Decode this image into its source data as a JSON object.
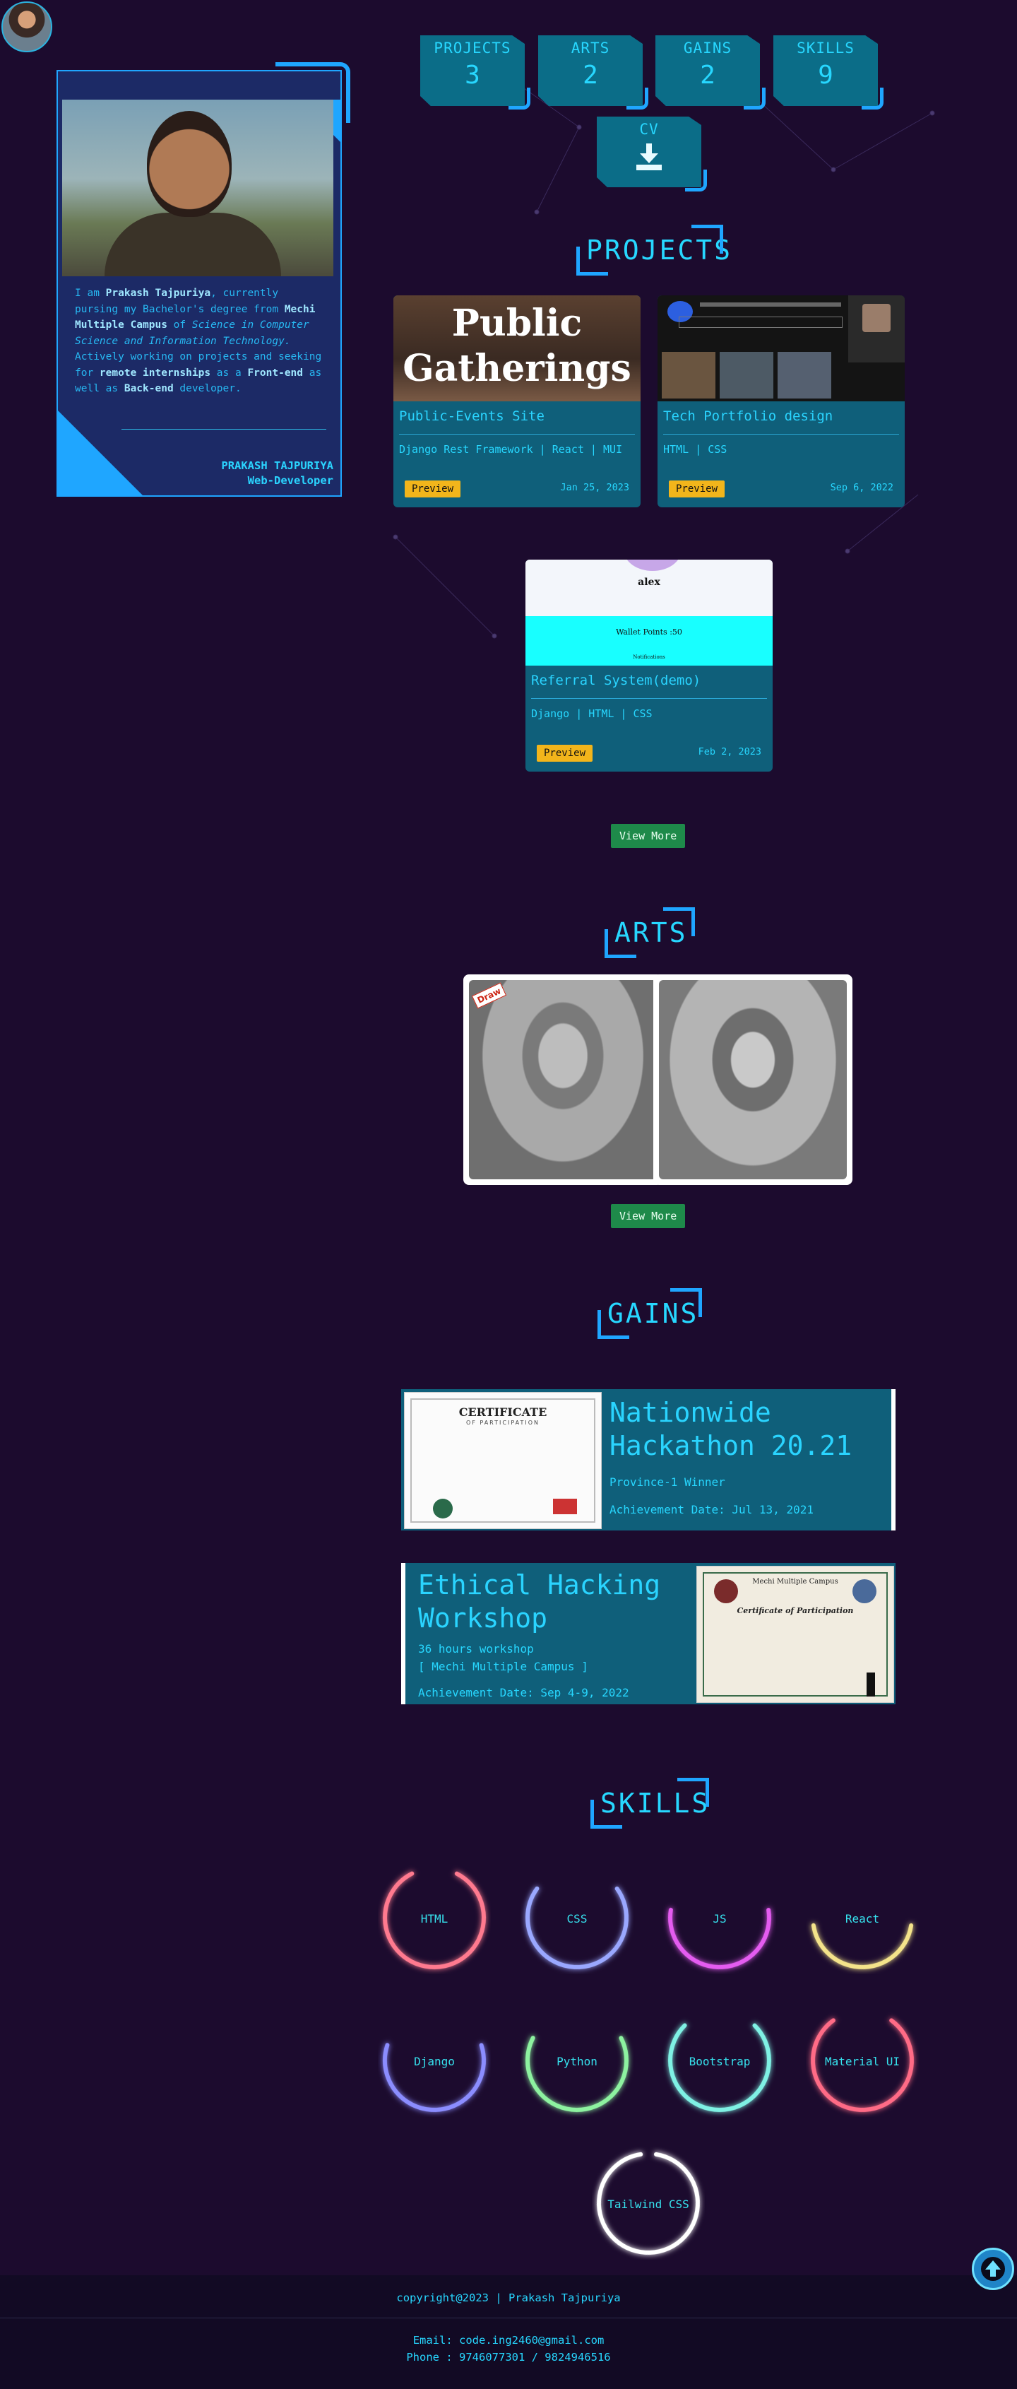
{
  "stats": [
    {
      "label": "PROJECTS",
      "value": "3"
    },
    {
      "label": "ARTS",
      "value": "2"
    },
    {
      "label": "GAINS",
      "value": "2"
    },
    {
      "label": "SKILLS",
      "value": "9"
    }
  ],
  "cv": {
    "label": "CV"
  },
  "profile": {
    "intro_pre": "I am ",
    "name_inline": "Prakash Tajpuriya",
    "intro_mid": ", currently pursing my Bachelor's degree from ",
    "college": "Mechi Multiple Campus",
    "intro_of": " of ",
    "degree": "Science in Computer Science and Information Technology.",
    "active": "Actively working on projects and seeking for ",
    "remote": "remote internships",
    "as_a": " as a ",
    "frontend": "Front-end",
    "as_well": " as well as ",
    "backend": "Back-end",
    "developer": " developer.",
    "name": "PRAKASH  TAJPURIYA",
    "role": "Web-Developer"
  },
  "sections": {
    "projects": "PROJECTS",
    "arts": "ARTS",
    "gains": "GAINS",
    "skills": "SKILLS"
  },
  "projects": [
    {
      "thumb_text_1": "Public",
      "thumb_text_2": "Gatherings",
      "title": "Public-Events Site",
      "tags": "Django Rest Framework | React | MUI",
      "button": "Preview",
      "date": "Jan 25, 2023"
    },
    {
      "title": "Tech Portfolio design",
      "tags": "HTML | CSS",
      "button": "Preview",
      "date": "Sep 6, 2022"
    },
    {
      "thumb_name": "alex",
      "thumb_wallet": "Wallet Points :50",
      "thumb_notif": "Notifications",
      "title": "Referral System(demo)",
      "tags": "Django | HTML | CSS",
      "button": "Preview",
      "date": "Feb 2, 2023"
    }
  ],
  "view_more": "View More",
  "art_badge": "Draw",
  "gains": [
    {
      "title": "Nationwide Hackathon 20.21",
      "sub": "Province-1 Winner",
      "date": "Achievement Date: Jul 13, 2021",
      "cert_head": "CERTIFICATE",
      "cert_sub": "OF PARTICIPATION"
    },
    {
      "title": "Ethical Hacking Workshop",
      "sub1": "36 hours workshop",
      "sub2": "[ Mechi Multiple Campus ]",
      "date": "Achievement Date: Sep 4-9, 2022",
      "cert_head": "Mechi Multiple Campus",
      "cert_sub": "Certificate of Participation"
    }
  ],
  "skills": [
    {
      "name": "HTML",
      "color": "#ff7a8f",
      "level": 0.85
    },
    {
      "name": "CSS",
      "color": "#9aa8ff",
      "level": 0.7
    },
    {
      "name": "JS",
      "color": "#e45cf0",
      "level": 0.55
    },
    {
      "name": "React",
      "color": "#f4e38a",
      "level": 0.45
    },
    {
      "name": "Django",
      "color": "#8b8dff",
      "level": 0.6
    },
    {
      "name": "Python",
      "color": "#8df2a0",
      "level": 0.65
    },
    {
      "name": "Bootstrap",
      "color": "#7ff1e4",
      "level": 0.75
    },
    {
      "name": "Material UI",
      "color": "#ff6b86",
      "level": 0.8
    },
    {
      "name": "Tailwind CSS",
      "color": "#ffffff",
      "level": 0.95
    }
  ],
  "footer": {
    "copyright": "copyright@2023 | Prakash Tajpuriya",
    "email": "Email: code.ing2460@gmail.com",
    "phone": "Phone : 9746077301 / 9824946516"
  }
}
